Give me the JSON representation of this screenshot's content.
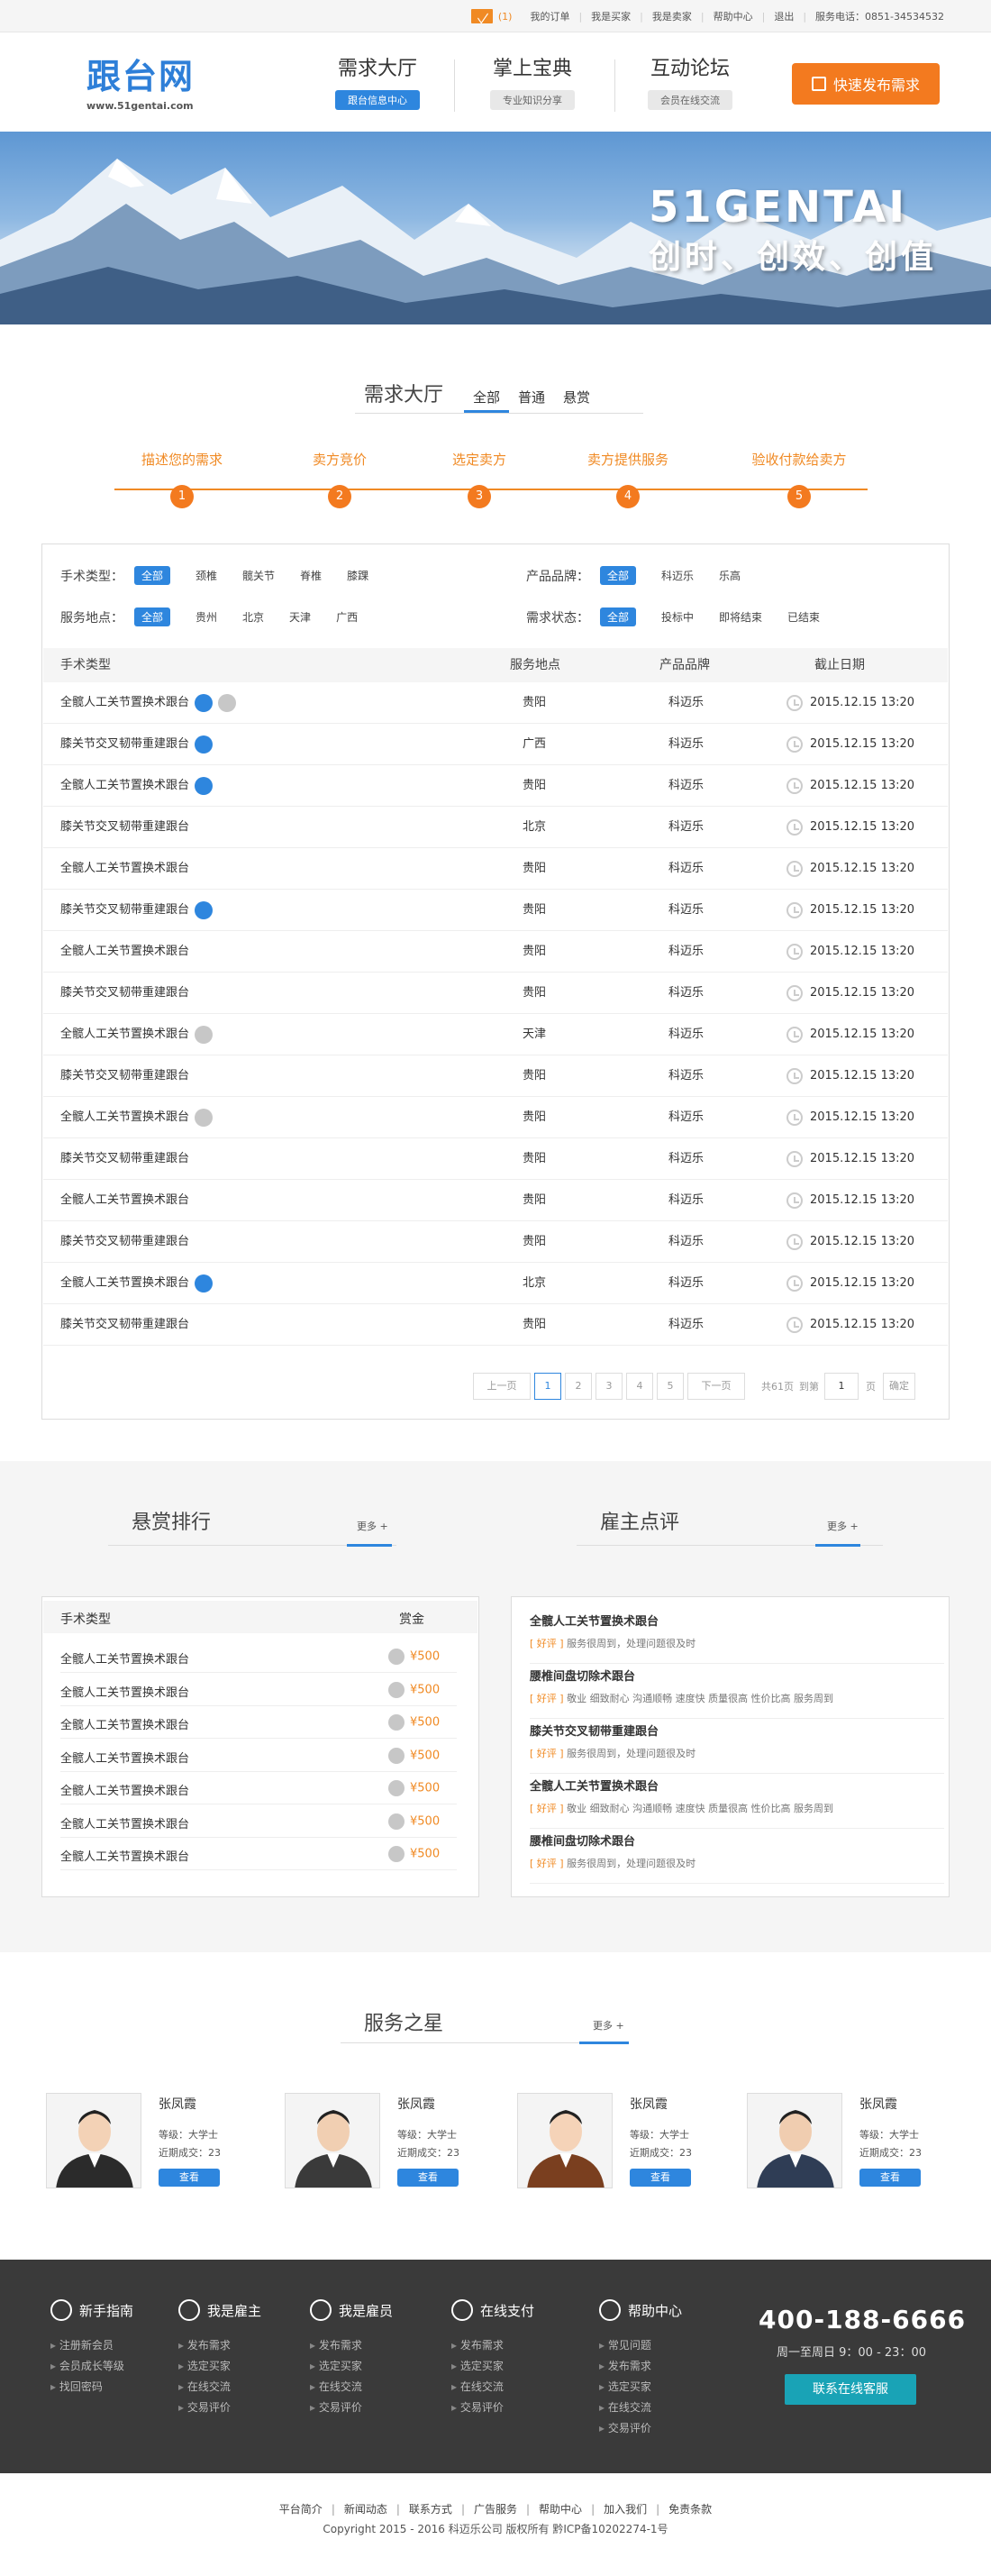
{
  "topbar": {
    "msg_count": "(1)",
    "links": [
      "我的订单",
      "我是买家",
      "我是卖家",
      "帮助中心",
      "退出",
      "服务电话：0851-34534532"
    ]
  },
  "header": {
    "logo_cn": "跟台网",
    "logo_url": "www.51gentai.com",
    "nav": [
      {
        "title": "需求大厅",
        "sub": "跟台信息中心",
        "active": true
      },
      {
        "title": "掌上宝典",
        "sub": "专业知识分享",
        "active": false
      },
      {
        "title": "互动论坛",
        "sub": "会员在线交流",
        "active": false
      }
    ],
    "publish": "快速发布需求"
  },
  "banner": {
    "title_en": "51GENTAI",
    "title_cn": "创时、创效、创值"
  },
  "demand": {
    "title": "需求大厅",
    "tabs": [
      "全部",
      "普通",
      "悬赏"
    ],
    "steps": [
      "描述您的需求",
      "卖方竞价",
      "选定卖方",
      "卖方提供服务",
      "验收付款给卖方"
    ],
    "step_nums": [
      "1",
      "2",
      "3",
      "4",
      "5"
    ]
  },
  "filters": {
    "type_label": "手术类型：",
    "type_opts": [
      "全部",
      "颈椎",
      "髋关节",
      "脊椎",
      "膝踝"
    ],
    "brand_label": "产品品牌：",
    "brand_opts": [
      "全部",
      "科迈乐",
      "乐高"
    ],
    "place_label": "服务地点：",
    "place_opts": [
      "全部",
      "贵州",
      "北京",
      "天津",
      "广西"
    ],
    "status_label": "需求状态：",
    "status_opts": [
      "全部",
      "投标中",
      "即将结束",
      "已结束"
    ]
  },
  "table": {
    "headers": [
      "手术类型",
      "服务地点",
      "产品品牌",
      "截止日期"
    ],
    "rows": [
      {
        "name": "全髋人工关节置换术跟台",
        "place": "贵阳",
        "brand": "科迈乐",
        "date": "2015.12.15 13:20",
        "badges": [
          "blue",
          "gray"
        ]
      },
      {
        "name": "膝关节交叉韧带重建跟台",
        "place": "广西",
        "brand": "科迈乐",
        "date": "2015.12.15 13:20",
        "badges": [
          "blue"
        ]
      },
      {
        "name": "全髋人工关节置换术跟台",
        "place": "贵阳",
        "brand": "科迈乐",
        "date": "2015.12.15 13:20",
        "badges": [
          "blue"
        ]
      },
      {
        "name": "膝关节交叉韧带重建跟台",
        "place": "北京",
        "brand": "科迈乐",
        "date": "2015.12.15 13:20",
        "badges": []
      },
      {
        "name": "全髋人工关节置换术跟台",
        "place": "贵阳",
        "brand": "科迈乐",
        "date": "2015.12.15 13:20",
        "badges": []
      },
      {
        "name": "膝关节交叉韧带重建跟台",
        "place": "贵阳",
        "brand": "科迈乐",
        "date": "2015.12.15 13:20",
        "badges": [
          "blue"
        ]
      },
      {
        "name": "全髋人工关节置换术跟台",
        "place": "贵阳",
        "brand": "科迈乐",
        "date": "2015.12.15 13:20",
        "badges": []
      },
      {
        "name": "膝关节交叉韧带重建跟台",
        "place": "贵阳",
        "brand": "科迈乐",
        "date": "2015.12.15 13:20",
        "badges": []
      },
      {
        "name": "全髋人工关节置换术跟台",
        "place": "天津",
        "brand": "科迈乐",
        "date": "2015.12.15 13:20",
        "badges": [
          "gray"
        ]
      },
      {
        "name": "膝关节交叉韧带重建跟台",
        "place": "贵阳",
        "brand": "科迈乐",
        "date": "2015.12.15 13:20",
        "badges": []
      },
      {
        "name": "全髋人工关节置换术跟台",
        "place": "贵阳",
        "brand": "科迈乐",
        "date": "2015.12.15 13:20",
        "badges": [
          "gray"
        ]
      },
      {
        "name": "膝关节交叉韧带重建跟台",
        "place": "贵阳",
        "brand": "科迈乐",
        "date": "2015.12.15 13:20",
        "badges": []
      },
      {
        "name": "全髋人工关节置换术跟台",
        "place": "贵阳",
        "brand": "科迈乐",
        "date": "2015.12.15 13:20",
        "badges": []
      },
      {
        "name": "膝关节交叉韧带重建跟台",
        "place": "贵阳",
        "brand": "科迈乐",
        "date": "2015.12.15 13:20",
        "badges": []
      },
      {
        "name": "全髋人工关节置换术跟台",
        "place": "北京",
        "brand": "科迈乐",
        "date": "2015.12.15 13:20",
        "badges": [
          "blue"
        ]
      },
      {
        "name": "膝关节交叉韧带重建跟台",
        "place": "贵阳",
        "brand": "科迈乐",
        "date": "2015.12.15 13:20",
        "badges": []
      }
    ]
  },
  "pager": {
    "prev": "上一页",
    "pages": [
      "1",
      "2",
      "3",
      "4",
      "5"
    ],
    "next": "下一页",
    "total": "共61页",
    "goto": "到第",
    "page_input": "1",
    "page_unit": "页",
    "confirm": "确定"
  },
  "ranking": {
    "title": "悬赏排行",
    "more": "更多 +",
    "headers": [
      "手术类型",
      "赏金"
    ],
    "rows": [
      {
        "name": "全髋人工关节置换术跟台",
        "reward": "¥500"
      },
      {
        "name": "全髋人工关节置换术跟台",
        "reward": "¥500"
      },
      {
        "name": "全髋人工关节置换术跟台",
        "reward": "¥500"
      },
      {
        "name": "全髋人工关节置换术跟台",
        "reward": "¥500"
      },
      {
        "name": "全髋人工关节置换术跟台",
        "reward": "¥500"
      },
      {
        "name": "全髋人工关节置换术跟台",
        "reward": "¥500"
      },
      {
        "name": "全髋人工关节置换术跟台",
        "reward": "¥500"
      }
    ]
  },
  "reviews": {
    "title": "雇主点评",
    "more": "更多 +",
    "items": [
      {
        "title": "全髋人工关节置换术跟台",
        "tag": "[ 好评 ]",
        "text": "服务很周到，处理问题很及时"
      },
      {
        "title": "腰椎间盘切除术跟台",
        "tag": "[ 好评 ]",
        "text": "敬业 细致耐心 沟通顺畅 速度快 质量很高 性价比高 服务周到"
      },
      {
        "title": "膝关节交叉韧带重建跟台",
        "tag": "[ 好评 ]",
        "text": "服务很周到，处理问题很及时"
      },
      {
        "title": "全髋人工关节置换术跟台",
        "tag": "[ 好评 ]",
        "text": "敬业 细致耐心 沟通顺畅 速度快 质量很高 性价比高 服务周到"
      },
      {
        "title": "腰椎间盘切除术跟台",
        "tag": "[ 好评 ]",
        "text": "服务很周到，处理问题很及时"
      }
    ]
  },
  "stars": {
    "title": "服务之星",
    "more": "更多 +",
    "people": [
      {
        "name": "张凤霞",
        "level": "等级：大学士",
        "deals": "近期成交：23",
        "btn": "查看"
      },
      {
        "name": "张凤霞",
        "level": "等级：大学士",
        "deals": "近期成交：23",
        "btn": "查看"
      },
      {
        "name": "张凤霞",
        "level": "等级：大学士",
        "deals": "近期成交：23",
        "btn": "查看"
      },
      {
        "name": "张凤霞",
        "level": "等级：大学士",
        "deals": "近期成交：23",
        "btn": "查看"
      }
    ]
  },
  "footer": {
    "cols": [
      {
        "title": "新手指南",
        "items": [
          "注册新会员",
          "会员成长等级",
          "找回密码"
        ]
      },
      {
        "title": "我是雇主",
        "items": [
          "发布需求",
          "选定买家",
          "在线交流",
          "交易评价"
        ]
      },
      {
        "title": "我是雇员",
        "items": [
          "发布需求",
          "选定买家",
          "在线交流",
          "交易评价"
        ]
      },
      {
        "title": "在线支付",
        "items": [
          "发布需求",
          "选定买家",
          "在线交流",
          "交易评价"
        ]
      },
      {
        "title": "帮助中心",
        "items": [
          "常见问题",
          "发布需求",
          "选定买家",
          "在线交流",
          "交易评价"
        ]
      }
    ],
    "phone": "400-188-6666",
    "worktime": "周一至周日 9：00 - 23：00",
    "kefu": "联系在线客服"
  },
  "bottom": {
    "links": [
      "平台简介",
      "新闻动态",
      "联系方式",
      "广告服务",
      "帮助中心",
      "加入我们",
      "免责条款"
    ],
    "copyright": "Copyright 2015 - 2016 科迈乐公司 版权所有 黔ICP备10202274-1号"
  }
}
